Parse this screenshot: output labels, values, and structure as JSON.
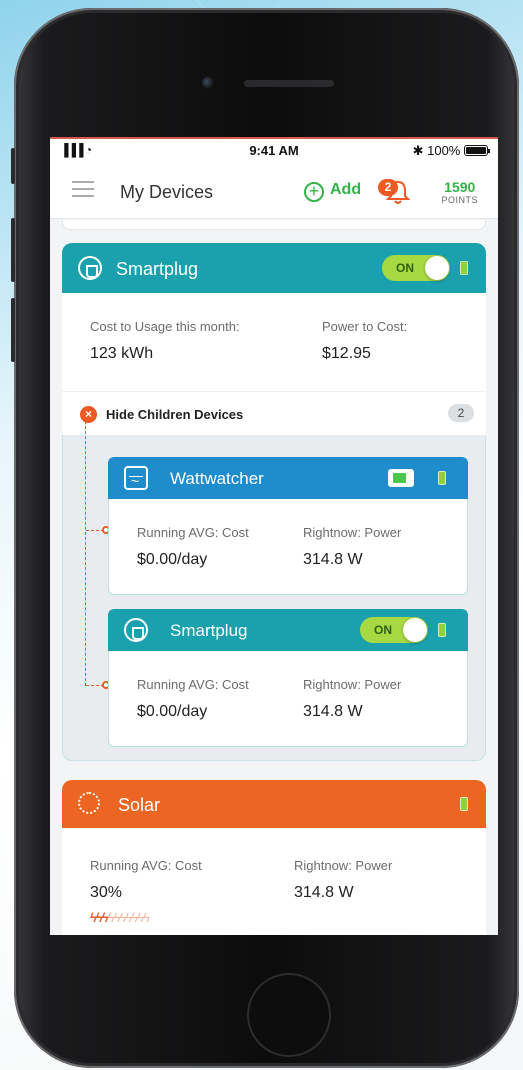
{
  "status_bar": {
    "signal": "▐▐▐ ◔",
    "time": "9:41 AM",
    "battery": "✱ 100%"
  },
  "nav": {
    "title": "My Devices",
    "add_label": "Add",
    "notification_count": "2",
    "points_value": "1590",
    "points_label": "POINTS"
  },
  "devices": [
    {
      "name": "Smartplug",
      "toggle": "ON",
      "metric1_label": "Cost to Usage this month:",
      "metric1_value": "123 kWh",
      "metric2_label": "Power to Cost:",
      "metric2_value": "$12.95",
      "children_toggle_label": "Hide Children Devices",
      "children_count": "2",
      "children": [
        {
          "name": "Wattwatcher",
          "metric1_label": "Running AVG: Cost",
          "metric1_value": "$0.00/day",
          "metric2_label": "Rightnow: Power",
          "metric2_value": "314.8 W"
        },
        {
          "name": "Smartplug",
          "toggle": "ON",
          "metric1_label": "Running AVG: Cost",
          "metric1_value": "$0.00/day",
          "metric2_label": "Rightnow: Power",
          "metric2_value": "314.8 W"
        }
      ]
    },
    {
      "name": "Solar",
      "metric1_label": "Running AVG: Cost",
      "metric1_value": "30%",
      "metric2_label": "Rightnow: Power",
      "metric2_value": "314.8 W",
      "rating_filled": 3,
      "rating_total": 10,
      "rating_glyphs": "ϟϟϟϟϟϟϟϟϟϟ"
    }
  ],
  "colors": {
    "teal": "#1aa1ad",
    "blue": "#1f8ccc",
    "orange": "#ec6522",
    "green": "#33b34a",
    "toggle_green": "#a7d943"
  },
  "icons": [
    "menu-icon",
    "add-circle-icon",
    "bell-icon",
    "smartplug-icon",
    "wattwatcher-icon",
    "solar-icon",
    "battery-icon",
    "close-circle-icon",
    "bolt-icon"
  ]
}
